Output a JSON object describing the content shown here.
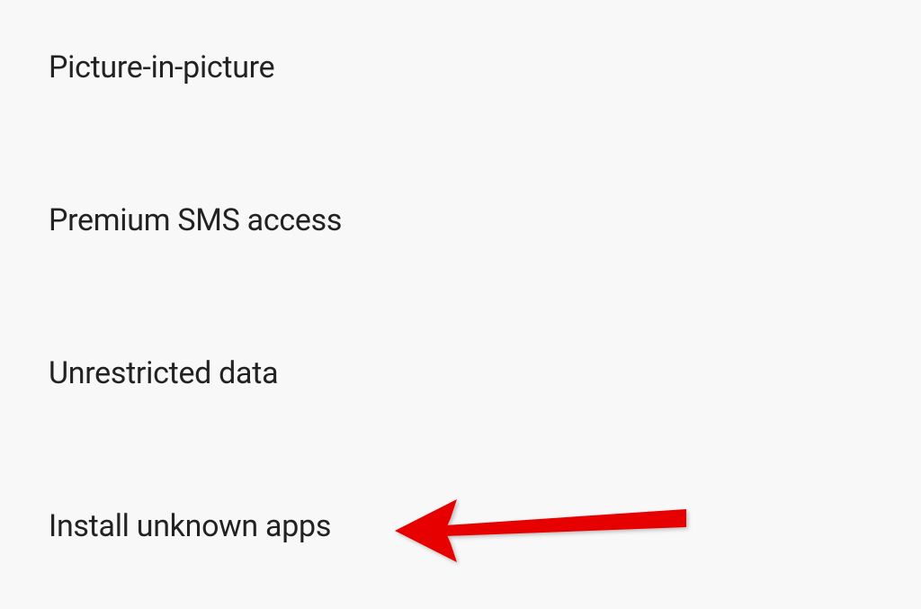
{
  "settings": {
    "items": [
      {
        "label": "Picture-in-picture"
      },
      {
        "label": "Premium SMS access"
      },
      {
        "label": "Unrestricted data"
      },
      {
        "label": "Install unknown apps"
      }
    ]
  },
  "annotation": {
    "type": "arrow",
    "color": "#e60000",
    "target": "settings-item-install-unknown-apps"
  }
}
